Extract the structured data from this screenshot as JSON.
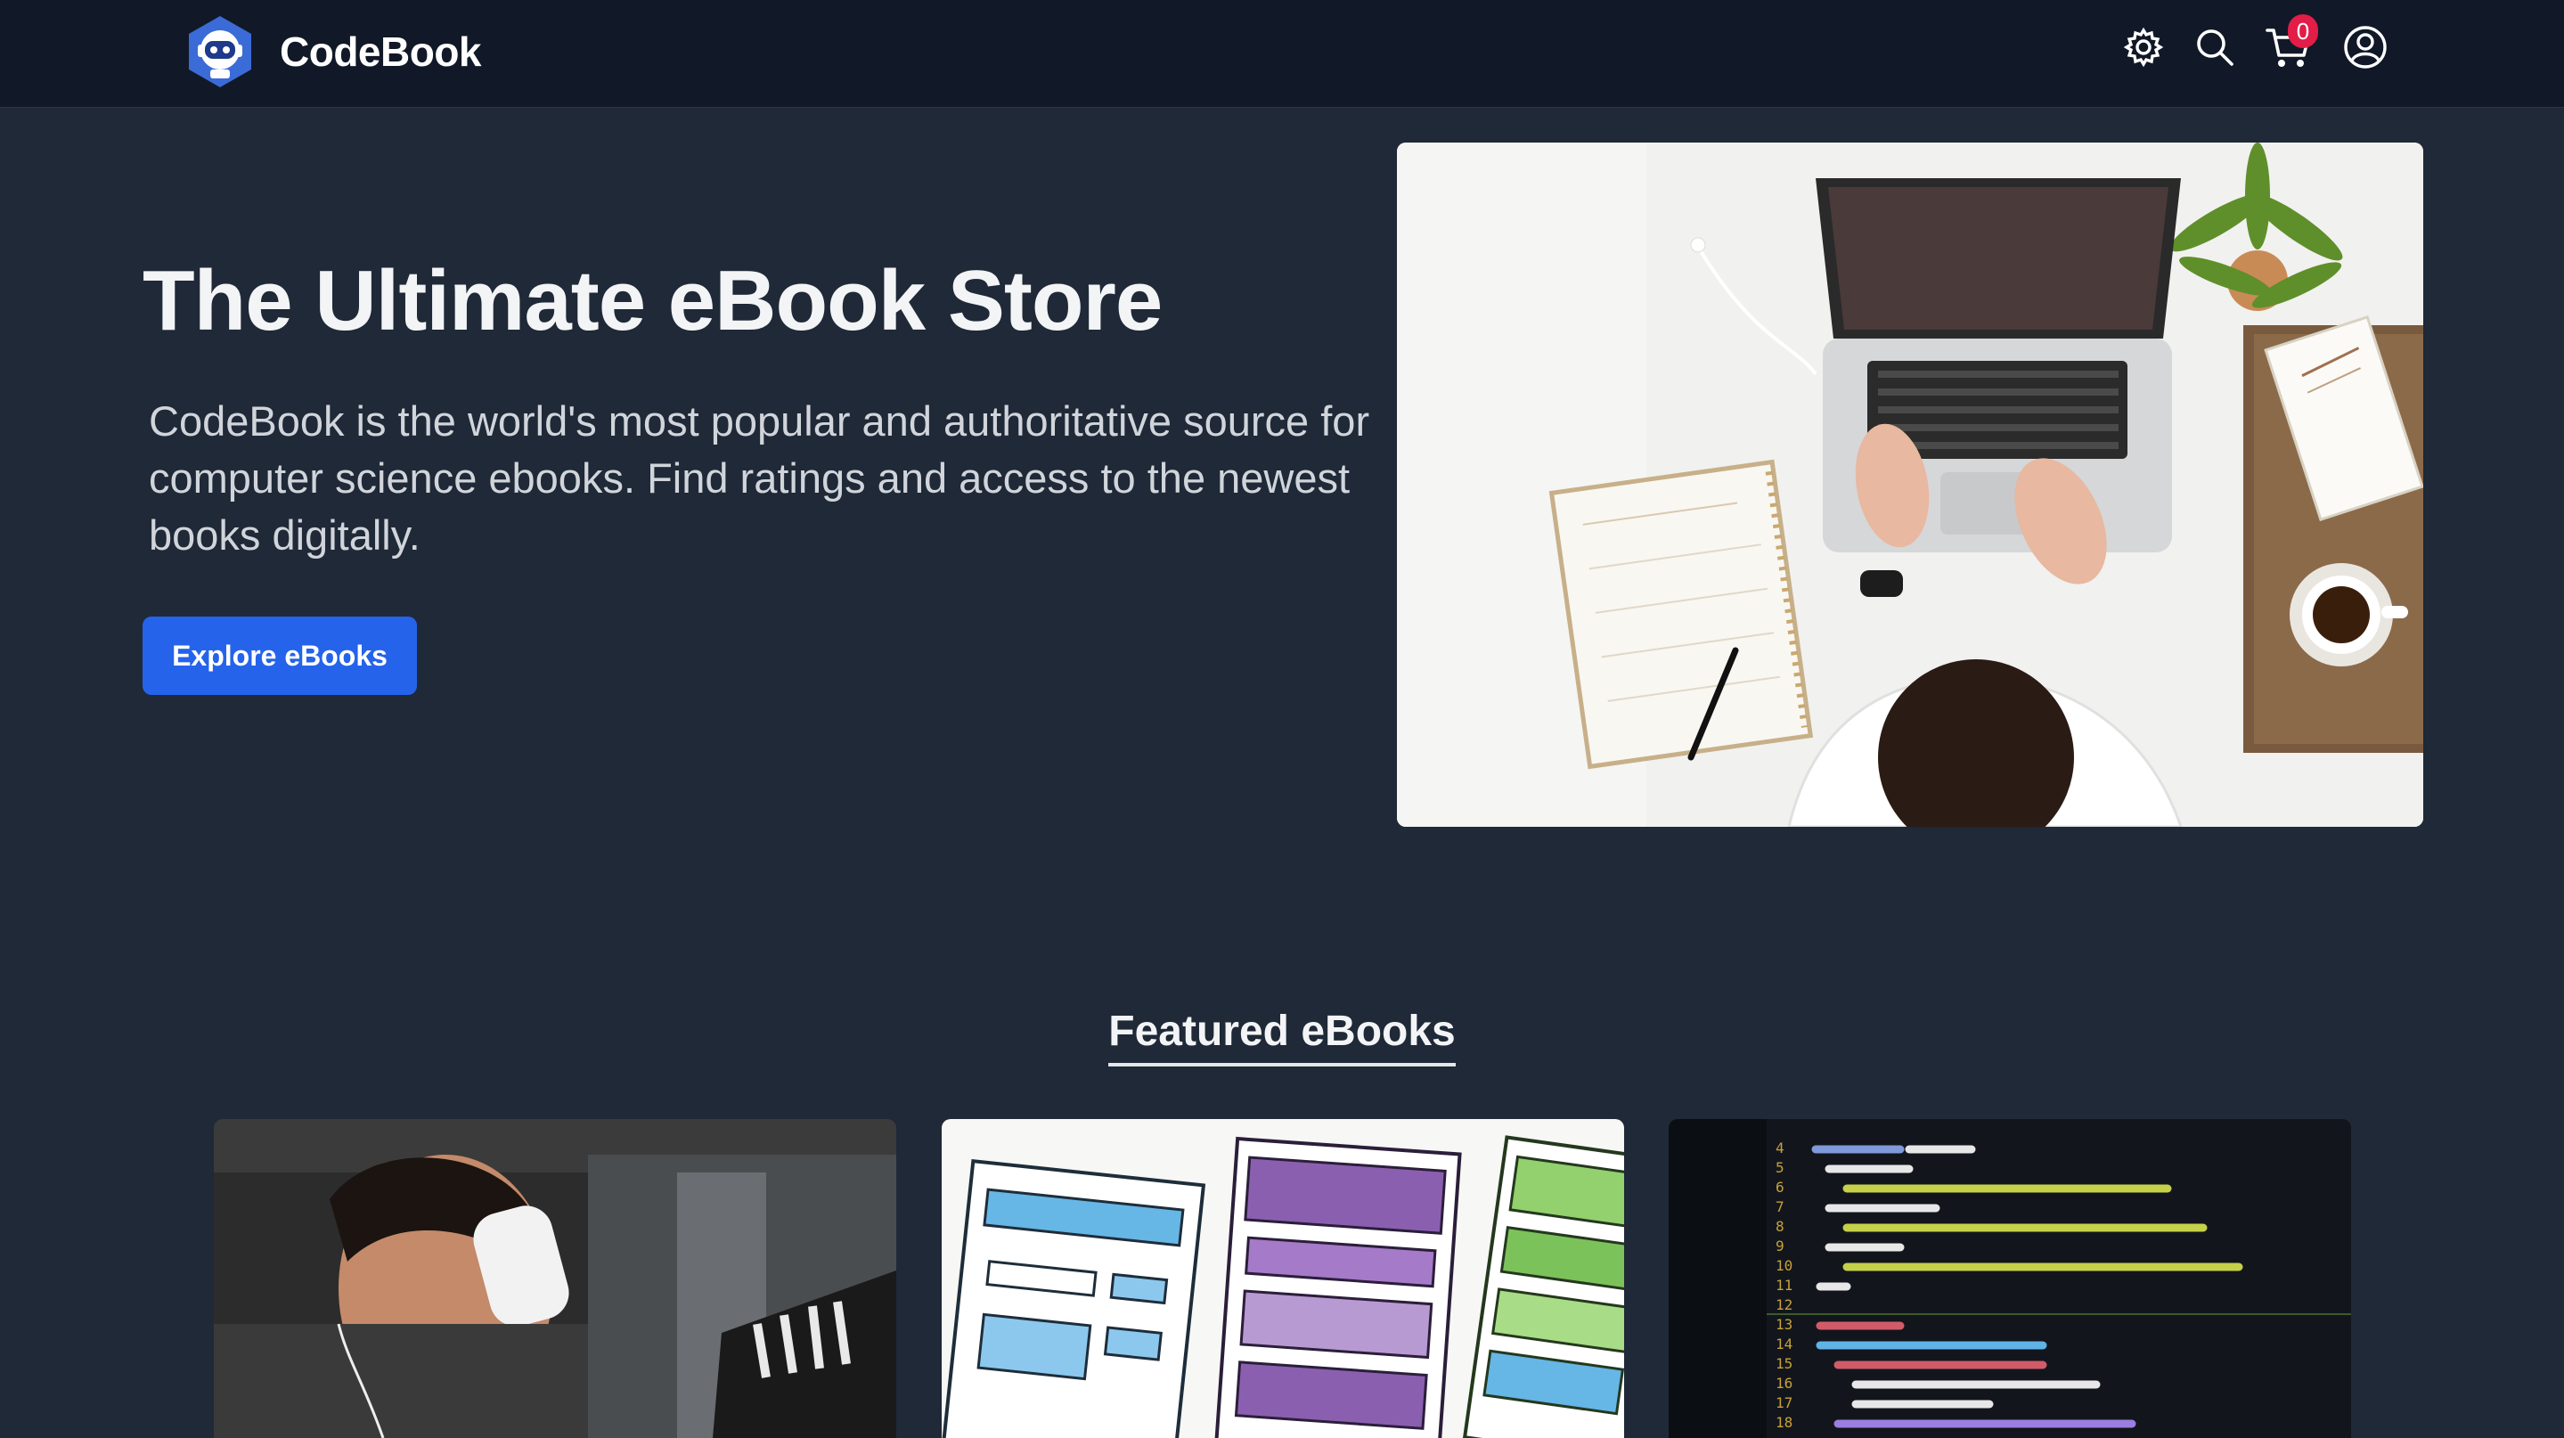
{
  "navbar": {
    "brand_name": "CodeBook",
    "cart_count": "0",
    "icons": [
      "logo-icon",
      "gear-icon",
      "search-icon",
      "cart-icon",
      "user-icon"
    ]
  },
  "hero": {
    "title": "The Ultimate eBook Store",
    "description": "CodeBook is the world's most popular and authoritative source for computer science ebooks. Find ratings and access to the newest books digitally.",
    "cta_label": "Explore eBooks",
    "image": "workspace-laptop-photo"
  },
  "featured": {
    "title": "Featured eBooks",
    "cards": [
      {
        "image": "developer-drinking-coffee-photo"
      },
      {
        "image": "wireframe-sketches-photo"
      },
      {
        "image": "code-editor-screen-photo"
      }
    ]
  },
  "colors": {
    "background": "#1f2937",
    "navbar": "#111827",
    "accent": "#2563eb",
    "badge": "#e11d48"
  }
}
